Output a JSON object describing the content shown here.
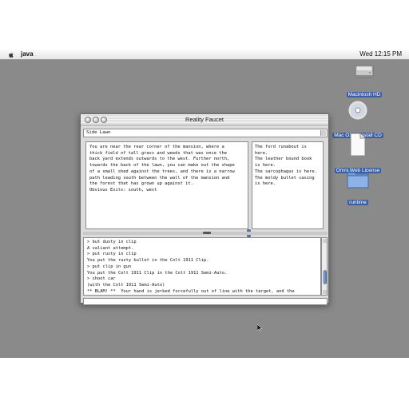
{
  "menubar": {
    "app_name": "java",
    "clock": "Wed 12:15 PM"
  },
  "desktop": {
    "icons": [
      {
        "label": "Macintosh HD",
        "icon": "hard-drive-icon"
      },
      {
        "label": "Mac OS X Install CD",
        "icon": "cd-icon"
      },
      {
        "label": "Omni.Web License",
        "icon": "document-icon"
      },
      {
        "label": "runtime",
        "icon": "folder-icon"
      }
    ]
  },
  "window": {
    "title": "Reality Faucet",
    "location": "Side Lawn",
    "description": "You are near the rear corner of the mansion, where a\nthick field of tall grass and weeds that was once the\nback yard extends outwards to the west. Further north,\ntowards the back of the lawn, you can make out the shape\nof a small shed against the trees, and there is a narrow\npath leading south between the wall of the mansion and\nthe forest that has grown up against it.\nObvious Exits: south, west",
    "items": "The ford runabout is\nhere.\nThe leather bound book\nis here.\nThe sarcophagus is here.\nThe moldy bullet casing\nis here.",
    "log": "> but dusty in clip\nA valiant attempt.\n> put rusty in clip\nYou put the rusty bullet in the Colt 1911 Clip.\n> put clip in gun\nYou put the Colt 1911 Clip in the Colt 1911 Semi-Auto.\n> shoot car\n(with the Colt 1911 Semi-Auto)\n** BLAM! **  Your hand is jerked forcefully out of line with the target, and the\nbullet goes wide.",
    "command": ""
  }
}
